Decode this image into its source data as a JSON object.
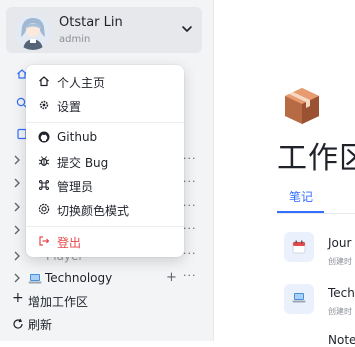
{
  "user": {
    "name": "Otstar Lin",
    "role": "admin"
  },
  "sidebar": {
    "workspaces": [
      {
        "label": "Player",
        "visible_label": "Player"
      },
      {
        "label": "Technology",
        "visible_label": "Technology"
      }
    ],
    "add_workspace": "增加工作区",
    "refresh": "刷新"
  },
  "menu": {
    "items": [
      {
        "label": "个人主页",
        "icon": "home-icon"
      },
      {
        "label": "设置",
        "icon": "gear-icon"
      },
      {
        "label": "Github",
        "icon": "github-icon"
      },
      {
        "label": "提交 Bug",
        "icon": "bug-icon"
      },
      {
        "label": "管理员",
        "icon": "command-icon"
      },
      {
        "label": "切换颜色模式",
        "icon": "theme-icon"
      },
      {
        "label": "登出",
        "icon": "logout-icon"
      }
    ]
  },
  "main": {
    "title": "工作区",
    "tab": "笔记",
    "docs": [
      {
        "title": "Jour",
        "sub": "创建时"
      },
      {
        "title": "Tech",
        "sub": "创建时"
      },
      {
        "title": "Note",
        "sub": ""
      }
    ]
  },
  "colors": {
    "accent": "#3370ff",
    "danger": "#e5484d",
    "sidebar_bg": "#f3f4f6"
  }
}
